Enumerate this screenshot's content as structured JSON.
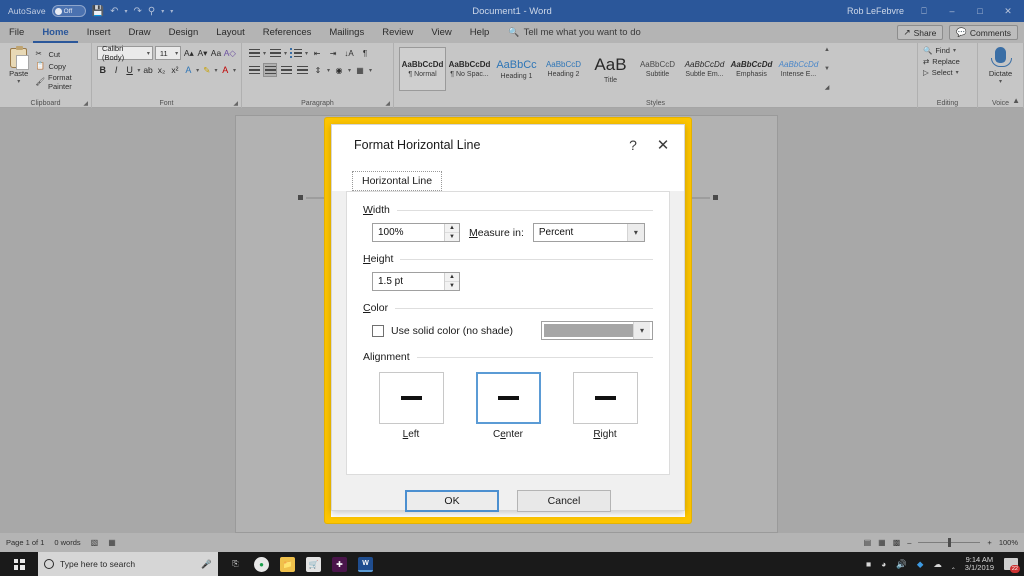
{
  "titlebar": {
    "autosave_label": "AutoSave",
    "autosave_state": "Off",
    "quick_access": [
      "save-icon",
      "undo-icon",
      "redo-icon",
      "touch-mode-icon",
      "customize-icon"
    ],
    "document_title": "Document1  -  Word",
    "user_name": "Rob LeFebvre",
    "ribbon_display_icon": "ribbon-display-options",
    "minimize": "–",
    "maximize": "□",
    "close": "✕"
  },
  "menubar": {
    "tabs": [
      "File",
      "Home",
      "Insert",
      "Draw",
      "Design",
      "Layout",
      "References",
      "Mailings",
      "Review",
      "View",
      "Help"
    ],
    "active_tab": "Home",
    "tellme_placeholder": "Tell me what you want to do",
    "share_label": "Share",
    "comments_label": "Comments"
  },
  "ribbon": {
    "groups": [
      {
        "name": "Clipboard",
        "paste_label": "Paste",
        "items": [
          "Cut",
          "Copy",
          "Format Painter"
        ]
      },
      {
        "name": "Font",
        "font_family": "Calibri (Body)",
        "font_size": "11",
        "row1": [
          "grow-font-icon",
          "shrink-font-icon",
          "change-case-icon",
          "clear-formatting-icon"
        ],
        "row2": [
          "bold-icon",
          "italic-icon",
          "underline-icon",
          "strikethrough-icon",
          "subscript-icon",
          "superscript-icon",
          "text-effects-icon",
          "highlight-icon",
          "font-color-icon"
        ]
      },
      {
        "name": "Paragraph",
        "row1": [
          "bullets-icon",
          "numbering-icon",
          "multilevel-list-icon",
          "decrease-indent-icon",
          "increase-indent-icon",
          "sort-icon",
          "show-marks-icon"
        ],
        "row2": [
          "align-left-icon",
          "align-center-icon",
          "align-right-icon",
          "justify-icon",
          "line-spacing-icon",
          "shading-icon",
          "borders-icon"
        ]
      },
      {
        "name": "Styles",
        "gallery": [
          {
            "preview": "AaBbCcDd",
            "label": "¶ Normal",
            "selected": true
          },
          {
            "preview": "AaBbCcDd",
            "label": "¶ No Spac...",
            "selected": false
          },
          {
            "preview": "AaBbCc",
            "label": "Heading 1",
            "selected": false
          },
          {
            "preview": "AaBbCcD",
            "label": "Heading 2",
            "selected": false
          },
          {
            "preview": "AaB",
            "label": "Title",
            "selected": false
          },
          {
            "preview": "AaBbCcD",
            "label": "Subtitle",
            "selected": false
          },
          {
            "preview": "AaBbCcDd",
            "label": "Subtle Em...",
            "selected": false
          },
          {
            "preview": "AaBbCcDd",
            "label": "Emphasis",
            "selected": false
          },
          {
            "preview": "AaBbCcDd",
            "label": "Intense E...",
            "selected": false
          }
        ]
      },
      {
        "name": "Editing",
        "items": [
          "Find",
          "Replace",
          "Select"
        ]
      },
      {
        "name": "Voice",
        "dictate_label": "Dictate"
      }
    ]
  },
  "dialog": {
    "title": "Format Horizontal Line",
    "help_icon": "?",
    "close_icon": "✕",
    "tab_label": "Horizontal Line",
    "width": {
      "section_label": "Width",
      "underline_char": "W",
      "value": "100%",
      "measure_label": "Measure in:",
      "measure_value": "Percent"
    },
    "height": {
      "section_label": "Height",
      "underline_char": "H",
      "value": "1.5 pt"
    },
    "color": {
      "section_label": "Color",
      "underline_char": "C",
      "checkbox_label": "Use solid color (no shade)",
      "checkbox_checked": false,
      "swatch_hex": "#a6a6a6"
    },
    "alignment": {
      "section_label": "Alignment",
      "options": [
        {
          "caption": "Left",
          "selected": false
        },
        {
          "caption": "Center",
          "selected": true
        },
        {
          "caption": "Right",
          "selected": false
        }
      ]
    },
    "buttons": {
      "ok": "OK",
      "cancel": "Cancel"
    },
    "highlight_color": "#fdc500"
  },
  "statusbar": {
    "page_info": "Page 1 of 1",
    "word_count": "0 words",
    "proofing_icon": "spell-check-icon",
    "language_icon": "language-icon",
    "view_icons": [
      "read-mode-icon",
      "print-layout-icon",
      "web-layout-icon"
    ],
    "zoom_out": "–",
    "zoom_in": "+",
    "zoom_level": "100%"
  },
  "taskbar": {
    "start_icon": "windows-start-icon",
    "search_placeholder": "Type here to search",
    "mic_icon": "microphone-icon",
    "pinned": [
      "task-view-icon",
      "chrome-icon",
      "file-explorer-icon",
      "microsoft-store-icon",
      "slack-icon",
      "word-icon"
    ],
    "tray": [
      "battery-icon",
      "wifi-icon",
      "volume-icon",
      "dropbox-icon",
      "onedrive-icon",
      "bluetooth-icon"
    ],
    "time": "9:14 AM",
    "date": "3/1/2019",
    "notification_count": "22"
  }
}
